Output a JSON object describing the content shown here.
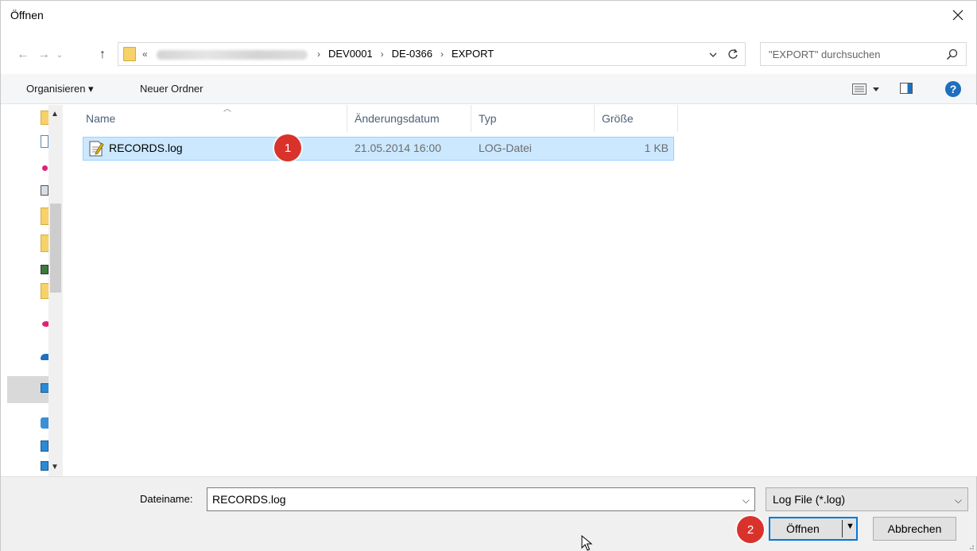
{
  "window": {
    "title": "Öffnen"
  },
  "address": {
    "ellipsis": "«",
    "crumbs": [
      "DEV0001",
      "DE-0366",
      "EXPORT"
    ],
    "separator": "›"
  },
  "search": {
    "placeholder": "\"EXPORT\" durchsuchen"
  },
  "toolbar": {
    "organize_label": "Organisieren ▾",
    "new_folder_label": "Neuer Ordner",
    "help_label": "?"
  },
  "columns": {
    "name": "Name",
    "date": "Änderungsdatum",
    "type": "Typ",
    "size": "Größe"
  },
  "files": [
    {
      "name": "RECORDS.log",
      "date": "21.05.2014 16:00",
      "type": "LOG-Datei",
      "size": "1 KB"
    }
  ],
  "callouts": {
    "first": "1",
    "second": "2"
  },
  "bottom": {
    "filename_label": "Dateiname:",
    "filename_value": "RECORDS.log",
    "filter_value": "Log File (*.log)",
    "open_label": "Öffnen",
    "cancel_label": "Abbrechen"
  },
  "colors": {
    "accent": "#0078d7",
    "selection": "#cce8ff",
    "badge": "#d9322b",
    "folder": "#f7d26a"
  }
}
